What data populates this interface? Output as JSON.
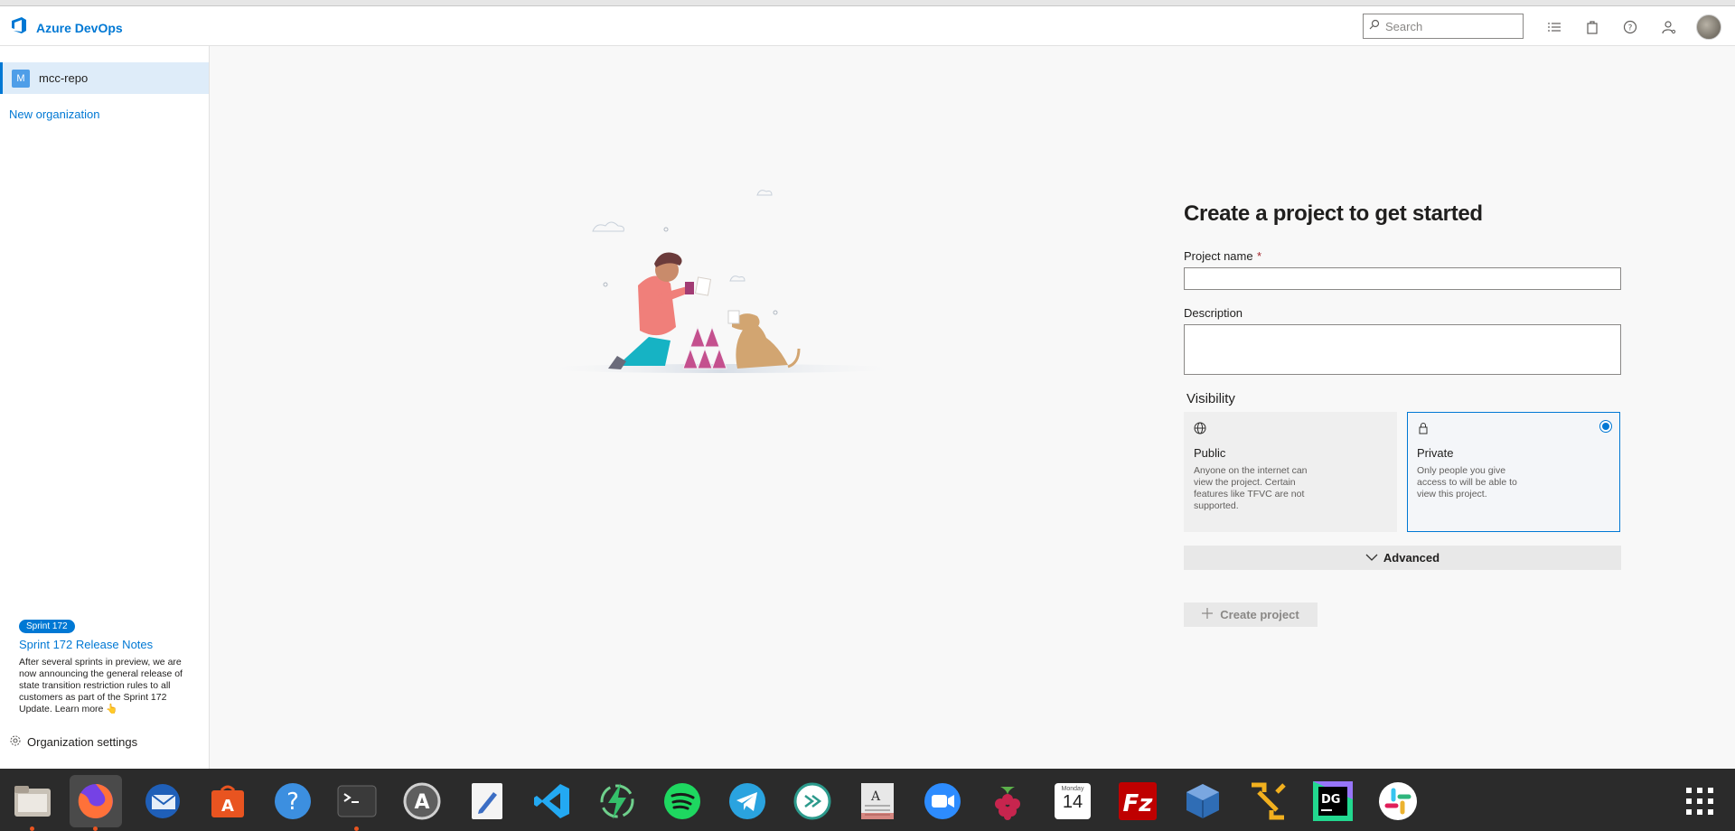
{
  "header": {
    "brand": "Azure DevOps",
    "search_placeholder": "Search"
  },
  "sidebar": {
    "org": {
      "badge": "M",
      "name": "mcc-repo"
    },
    "new_org_label": "New organization",
    "release": {
      "badge": "Sprint 172",
      "title": "Sprint 172 Release Notes",
      "body": "After several sprints in preview, we are now announcing the general release of state transition restriction rules to all customers as part of the Sprint 172 Update.",
      "learn_more": "Learn more"
    },
    "settings_label": "Organization settings"
  },
  "form": {
    "title": "Create a project to get started",
    "project_name_label": "Project name",
    "required_marker": "*",
    "description_label": "Description",
    "visibility_label": "Visibility",
    "public": {
      "title": "Public",
      "description": "Anyone on the internet can view the project. Certain features like TFVC are not supported."
    },
    "private": {
      "title": "Private",
      "description": "Only people you give access to will be able to view this project.",
      "selected": true
    },
    "advanced_label": "Advanced",
    "create_label": "Create project"
  },
  "dock": {
    "apps": [
      "files",
      "firefox",
      "thunderbird",
      "software-center",
      "help",
      "terminal",
      "software-updater",
      "text-editor",
      "vscode",
      "lightning",
      "spotify",
      "telegram",
      "remote-desktop",
      "document-viewer",
      "zoom",
      "raspberry-pi",
      "calendar",
      "filezilla",
      "virtualbox",
      "network-tool",
      "datagrip",
      "slack",
      "app-grid"
    ],
    "calendar": {
      "weekday": "Monday",
      "day": "14"
    }
  },
  "colors": {
    "accent": "#0078d4",
    "dock_bg": "#2b2b2b"
  }
}
